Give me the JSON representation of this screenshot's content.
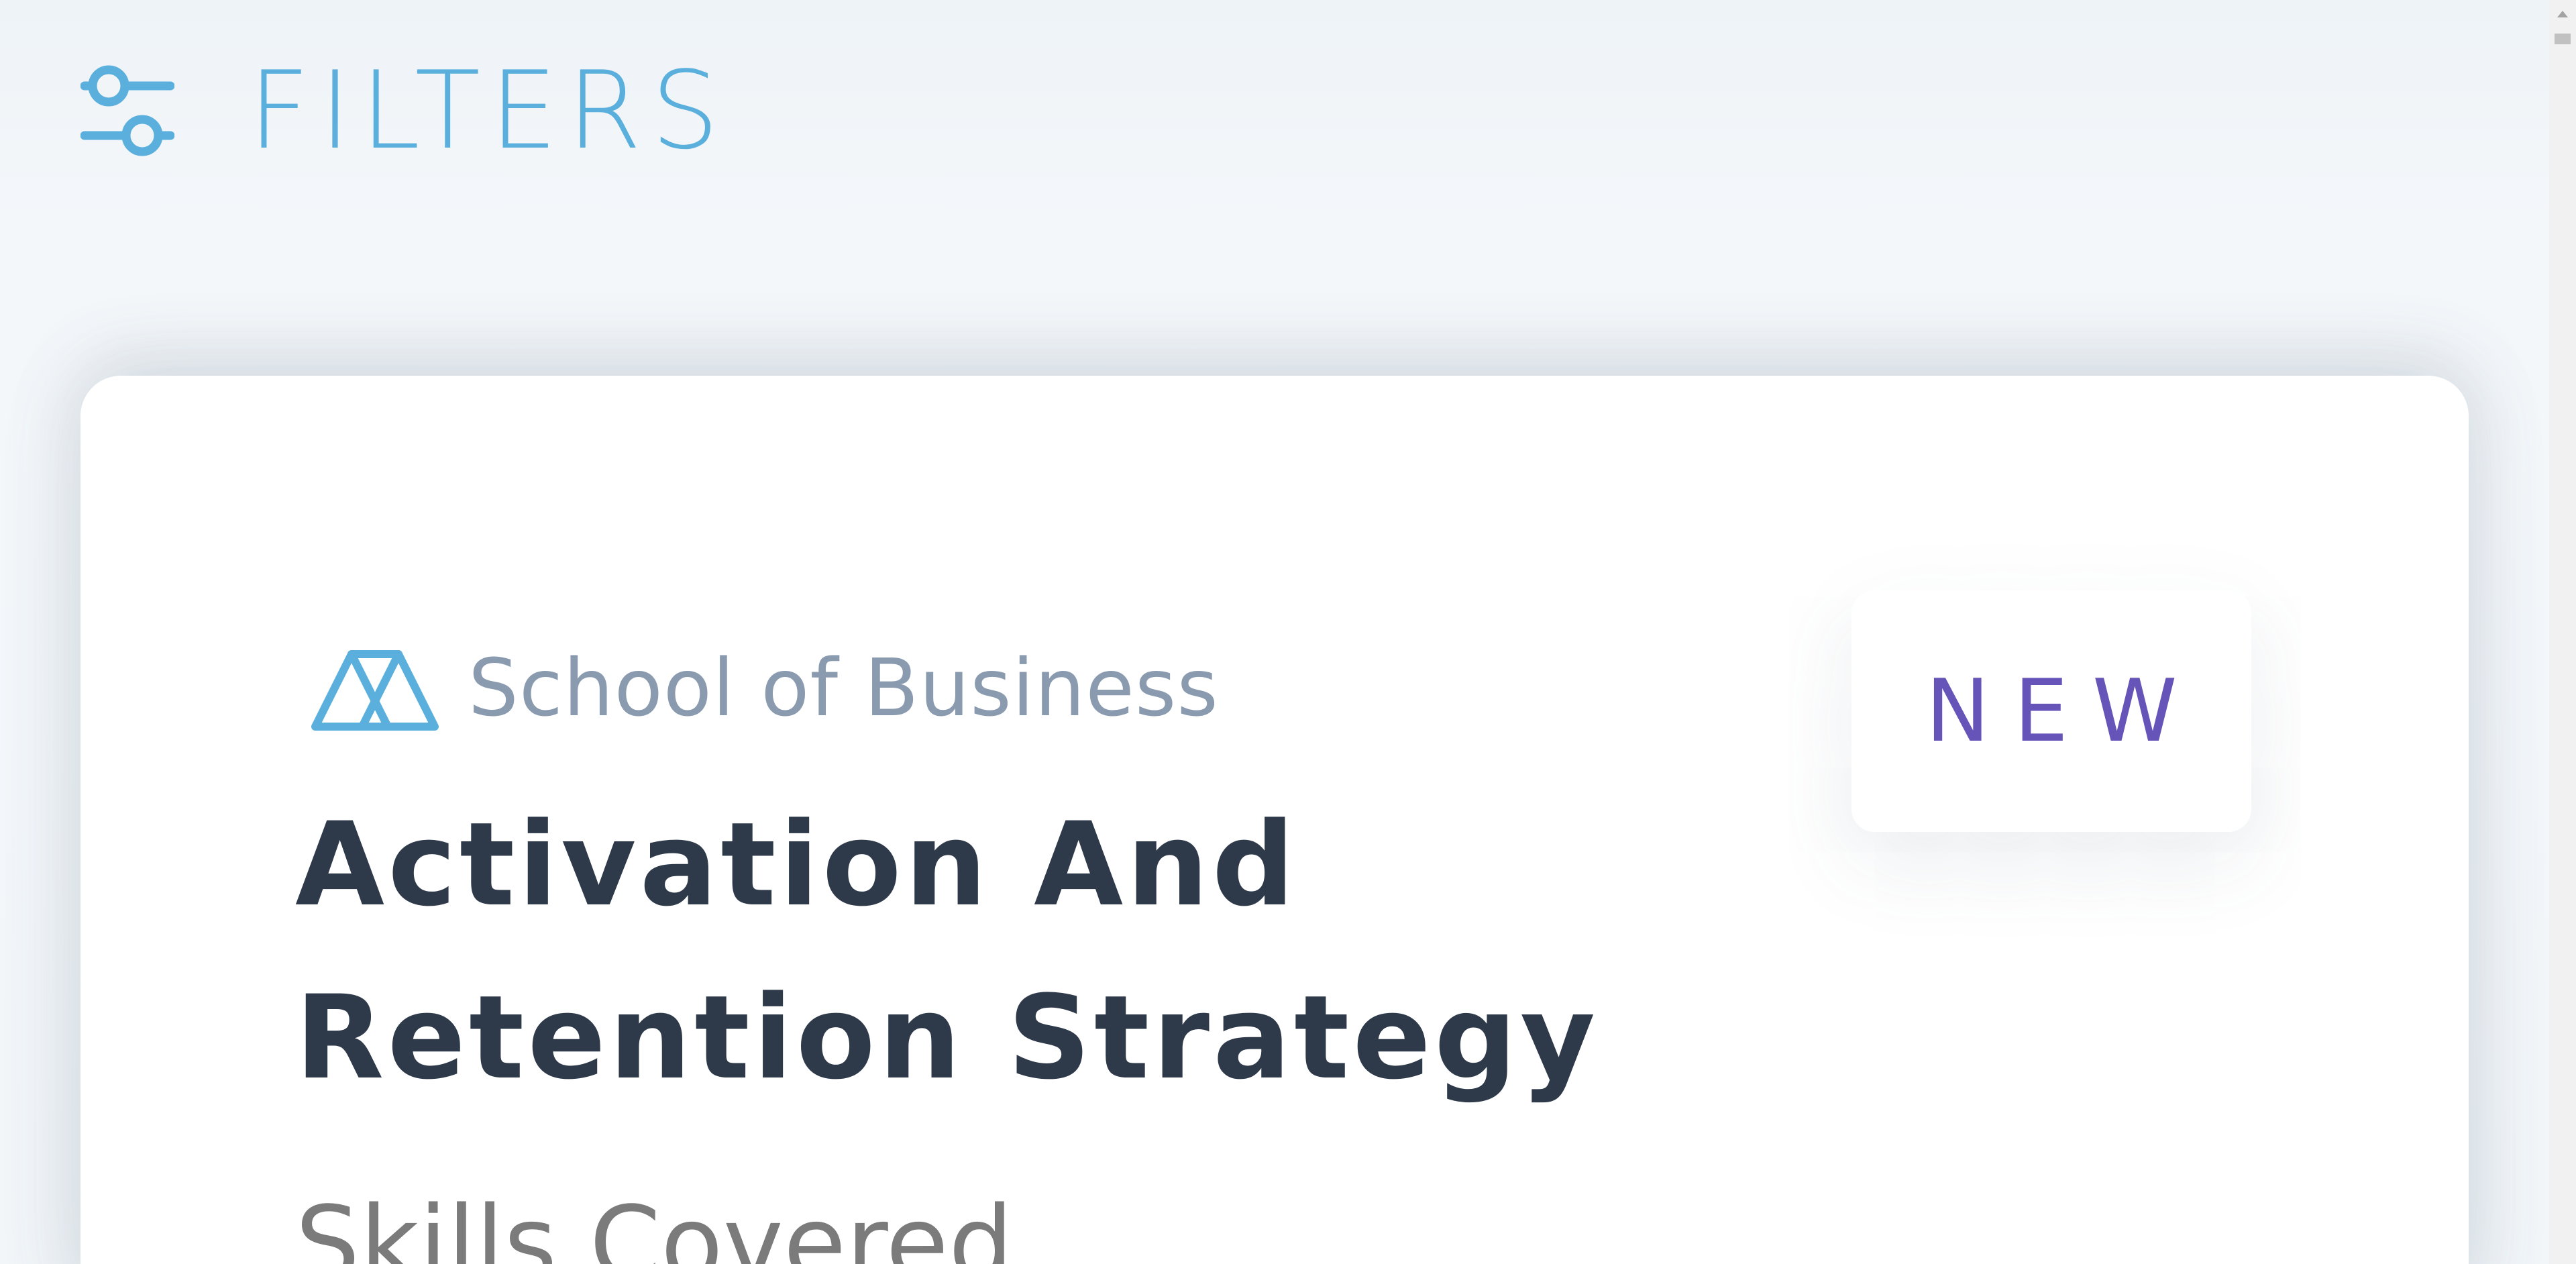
{
  "header": {
    "filters_label": "FILTERS",
    "icon": "sliders-icon",
    "accent_color": "#5aafdc"
  },
  "course_card": {
    "school": {
      "name": "School of Business",
      "logo_icon": "school-logo-icon",
      "logo_color": "#5aafdc"
    },
    "badge": {
      "label": "NEW",
      "color": "#6654b8"
    },
    "title": "Activation And Retention Strategy",
    "skills_heading": "Skills Covered"
  },
  "colors": {
    "background": "#f2f6f9",
    "card": "#ffffff",
    "title_text": "#2e3a4a",
    "school_text": "#8a9bb0",
    "skills_text": "#7b7b7b"
  }
}
